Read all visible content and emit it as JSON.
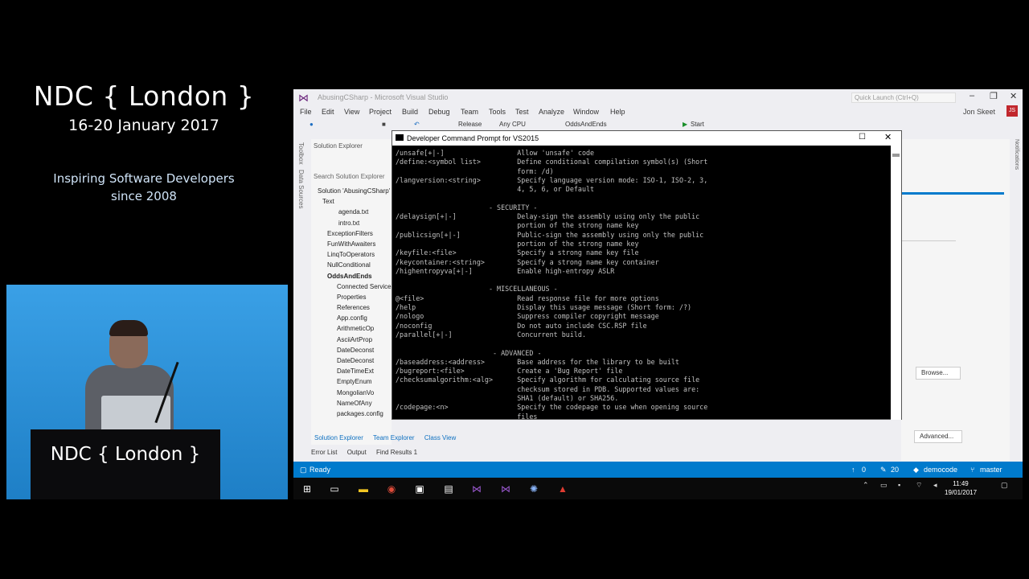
{
  "brand": {
    "logo": "NDC { London }",
    "dates": "16-20 January 2017",
    "tagline_1": "Inspiring Software Developers",
    "tagline_2": "since 2008",
    "podium_logo": "NDC { London }"
  },
  "vs": {
    "title": "AbusingCSharp - Microsoft Visual Studio",
    "quick_launch": "Quick Launch (Ctrl+Q)",
    "menu": [
      "File",
      "Edit",
      "View",
      "Project",
      "Build",
      "Debug",
      "Team",
      "Tools",
      "Test",
      "Analyze",
      "Window",
      "Help"
    ],
    "user": "Jon Skeet",
    "avatar": "JS",
    "toolbar": {
      "config": "Release",
      "platform": "Any CPU",
      "project": "OddsAndEnds",
      "start": "Start"
    },
    "sidestrip": [
      "Toolbox",
      "Data Sources"
    ],
    "solution_explorer": {
      "header": "Solution Explorer",
      "search": "Search Solution Explorer",
      "tree": [
        "Solution 'AbusingCSharp'",
        "Text",
        "agenda.txt",
        "intro.txt",
        "ExceptionFilters",
        "FunWithAwaiters",
        "LinqToOperators",
        "NullConditional",
        "OddsAndEnds",
        "Connected Services",
        "Properties",
        "References",
        "App.config",
        "ArithmeticOp",
        "AsciiArtProp",
        "DateDeconst",
        "DateDeconst",
        "DateTimeExt",
        "EmptyEnum",
        "MongolianVo",
        "NameOfAny",
        "packages.config"
      ],
      "tabs": [
        "Solution Explorer",
        "Team Explorer",
        "Class View"
      ]
    },
    "bottom_tabs": [
      "Error List",
      "Output",
      "Find Results 1"
    ],
    "right_panel": {
      "browse": "Browse...",
      "advanced": "Advanced...",
      "notifications": "Notifications"
    },
    "status": {
      "ready": "Ready",
      "up_count": "0",
      "edit_count": "20",
      "repo": "democode",
      "branch": "master"
    }
  },
  "cmd": {
    "title": "Developer Command Prompt for VS2015",
    "lines": [
      "/unsafe[+|-]                  Allow 'unsafe' code",
      "/define:<symbol list>         Define conditional compilation symbol(s) (Short",
      "                              form: /d)",
      "/langversion:<string>         Specify language version mode: ISO-1, ISO-2, 3,",
      "                              4, 5, 6, or Default",
      "",
      "                       - SECURITY -",
      "/delaysign[+|-]               Delay-sign the assembly using only the public",
      "                              portion of the strong name key",
      "/publicsign[+|-]              Public-sign the assembly using only the public",
      "                              portion of the strong name key",
      "/keyfile:<file>               Specify a strong name key file",
      "/keycontainer:<string>        Specify a strong name key container",
      "/highentropyva[+|-]           Enable high-entropy ASLR",
      "",
      "                       - MISCELLANEOUS -",
      "@<file>                       Read response file for more options",
      "/help                         Display this usage message (Short form: /?)",
      "/nologo                       Suppress compiler copyright message",
      "/noconfig                     Do not auto include CSC.RSP file",
      "/parallel[+|-]                Concurrent build.",
      "",
      "                        - ADVANCED -",
      "/baseaddress:<address>        Base address for the library to be built",
      "/bugreport:<file>             Create a 'Bug Report' file",
      "/checksumalgorithm:<alg>      Specify algorithm for calculating source file",
      "                              checksum stored in PDB. Supported values are:",
      "                              SHA1 (default) or SHA256.",
      "/codepage:<n>                 Specify the codepage to use when opening source",
      "                              files"
    ]
  },
  "taskbar": {
    "time": "11:49",
    "date": "19/01/2017"
  }
}
